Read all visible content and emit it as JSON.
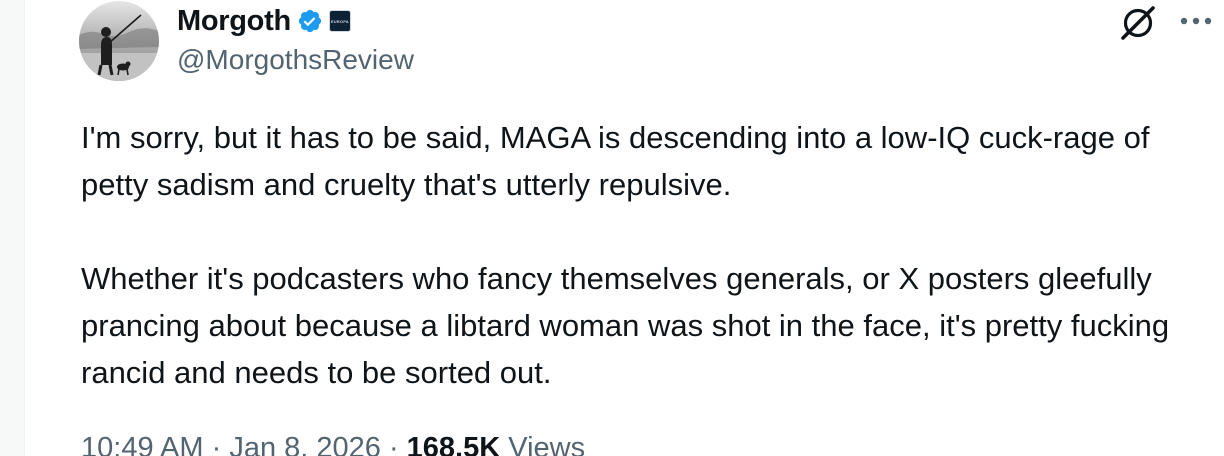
{
  "author": {
    "display_name": "Morgoth",
    "handle": "@MorgothsReview",
    "affiliation_badge_text": "EUROPA",
    "verified_color": "#1d9bf0"
  },
  "tweet": {
    "paragraphs": [
      "I'm sorry, but it has to be said, MAGA is descending into a low-IQ cuck-rage of petty sadism and cruelty that's utterly repulsive.",
      "Whether it's podcasters who fancy themselves generals, or X posters gleefully prancing about because a libtard woman was shot in the face, it's pretty fucking rancid and needs to be sorted out."
    ]
  },
  "meta": {
    "time": "10:49 AM",
    "separator": " · ",
    "date": "Jan 8, 2026",
    "views_count": "168.5K",
    "views_label": " Views"
  },
  "icons": {
    "grok": "grok-icon",
    "more": "more-icon",
    "verified": "verified-badge-icon"
  }
}
